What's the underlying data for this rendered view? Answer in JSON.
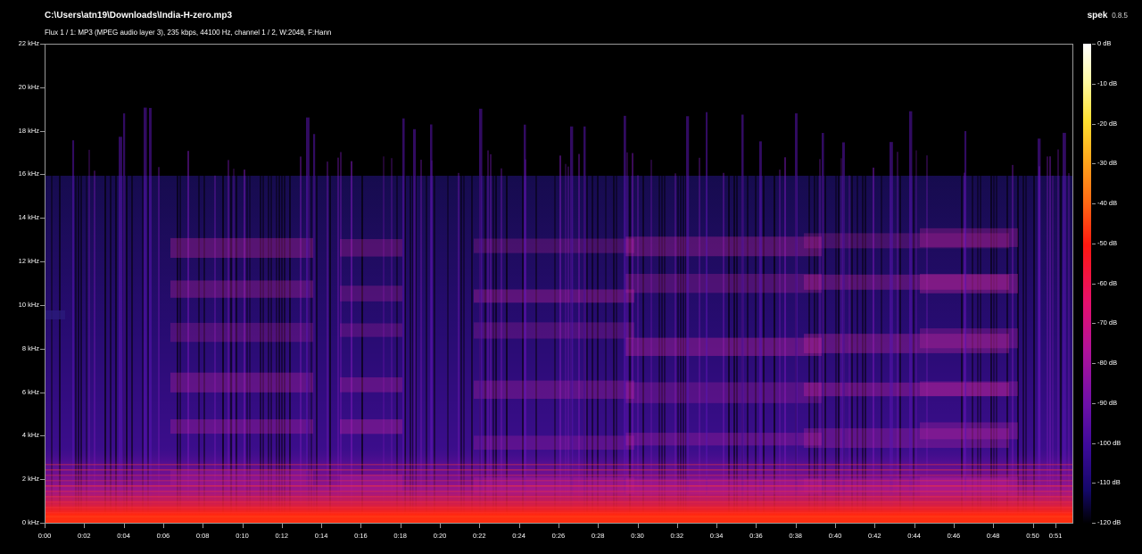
{
  "window": {
    "file_path": "C:\\Users\\atn19\\Downloads\\India-H-zero.mp3",
    "info": "Flux 1 / 1: MP3 (MPEG audio layer 3), 235 kbps, 44100 Hz, channel 1 / 2, W:2048, F:Hann",
    "app_name": "spek",
    "app_version": "0.8.5"
  },
  "frequency_axis": {
    "labels": [
      "22 kHz",
      "20 kHz",
      "18 kHz",
      "16 kHz",
      "14 kHz",
      "12 kHz",
      "10 kHz",
      "8 kHz",
      "6 kHz",
      "4 kHz",
      "2 kHz",
      "0 kHz"
    ]
  },
  "time_axis": {
    "labels": [
      "0:00",
      "0:02",
      "0:04",
      "0:06",
      "0:08",
      "0:10",
      "0:12",
      "0:14",
      "0:16",
      "0:18",
      "0:20",
      "0:22",
      "0:24",
      "0:26",
      "0:28",
      "0:30",
      "0:32",
      "0:34",
      "0:36",
      "0:38",
      "0:40",
      "0:42",
      "0:44",
      "0:46",
      "0:48",
      "0:50",
      "0:51"
    ]
  },
  "colorbar": {
    "labels": [
      "0 dB",
      "-10 dB",
      "-20 dB",
      "-30 dB",
      "-40 dB",
      "-50 dB",
      "-60 dB",
      "-70 dB",
      "-80 dB",
      "-90 dB",
      "-100 dB",
      "-110 dB",
      "-120 dB"
    ]
  },
  "colors": {
    "background": "#000000",
    "frame": "#9a9a9a",
    "low_band": "#ff2a10",
    "mid_magenta": "#c0209a",
    "deep_purple": "#3a0c8a"
  }
}
